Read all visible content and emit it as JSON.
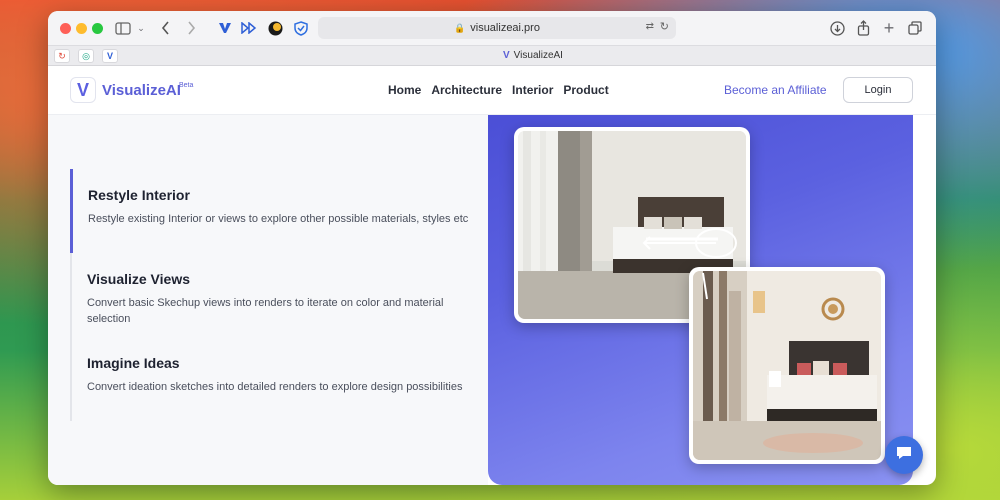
{
  "browser": {
    "url": "visualizeai.pro",
    "tab_title": "VisualizeAI",
    "tab_favicon_letter": "V"
  },
  "site": {
    "brand": "VisualizeAI",
    "beta": "Beta",
    "logo_letter": "V",
    "nav": [
      "Home",
      "Architecture",
      "Interior",
      "Product"
    ],
    "affiliate": "Become an Affiliate",
    "login": "Login",
    "accent_color": "#5b5fd6"
  },
  "features": [
    {
      "title": "Restyle Interior",
      "description": "Restyle existing Interior or views to explore other possible materials, styles etc",
      "active": true
    },
    {
      "title": "Visualize Views",
      "description": "Convert basic Skechup views into renders to iterate on color and material selection",
      "active": false
    },
    {
      "title": "Imagine Ideas",
      "description": "Convert ideation sketches into detailed renders to explore design possibilities",
      "active": false
    }
  ],
  "icons": {
    "chat": "chat-bubble-icon"
  }
}
